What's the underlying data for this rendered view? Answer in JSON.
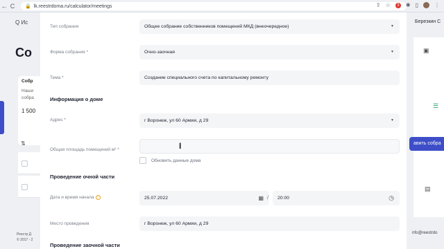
{
  "browser": {
    "url": "lk.reestrdoma.ru/calculator/meetings",
    "badge_count": "3",
    "nav_back": "←",
    "nav_reload": "C",
    "lock_icon": "lock-icon"
  },
  "background_left": {
    "search_text": "Q Ис",
    "page_title": "Со",
    "card_title": "Собр",
    "card_line1": "Наши",
    "card_line2": "собра",
    "card_price": "1 500",
    "footer_line1": "Реестр Д",
    "footer_line2": "© 2017 - 2"
  },
  "background_right": {
    "user_name": "Березкин С",
    "add_button": "авить собра",
    "email": "nfo@reestrdo"
  },
  "form": {
    "meeting_type": {
      "label": "Тип собрания",
      "value": "Общее собрание собственников помещений МКД (внеочередное)"
    },
    "meeting_form": {
      "label": "Форма собрания *",
      "value": "Очно-заочная"
    },
    "topic": {
      "label": "Тема *",
      "value": "Создание специального счета по капитальному ремонту"
    },
    "house_section": "Информация о доме",
    "address": {
      "label": "Адрес *",
      "value": "г Воронеж, ул 60 Армии, д 29"
    },
    "area": {
      "label": "Общая площадь помещений м² *",
      "value": ""
    },
    "update_checkbox_label": "Обновить данные дома",
    "in_person_section": "Проведение очной части",
    "start": {
      "label": "Дата и время начала",
      "date": "25.07.2022",
      "time": "20:00"
    },
    "venue": {
      "label": "Место проведения",
      "value": "г Воронеж, ул 60 Армии, д 29"
    },
    "remote_section": "Проведение заочной части"
  },
  "colors": {
    "accent": "#3d4ec8",
    "warning": "#e3a41e",
    "field_bg": "#f4f5f7"
  }
}
